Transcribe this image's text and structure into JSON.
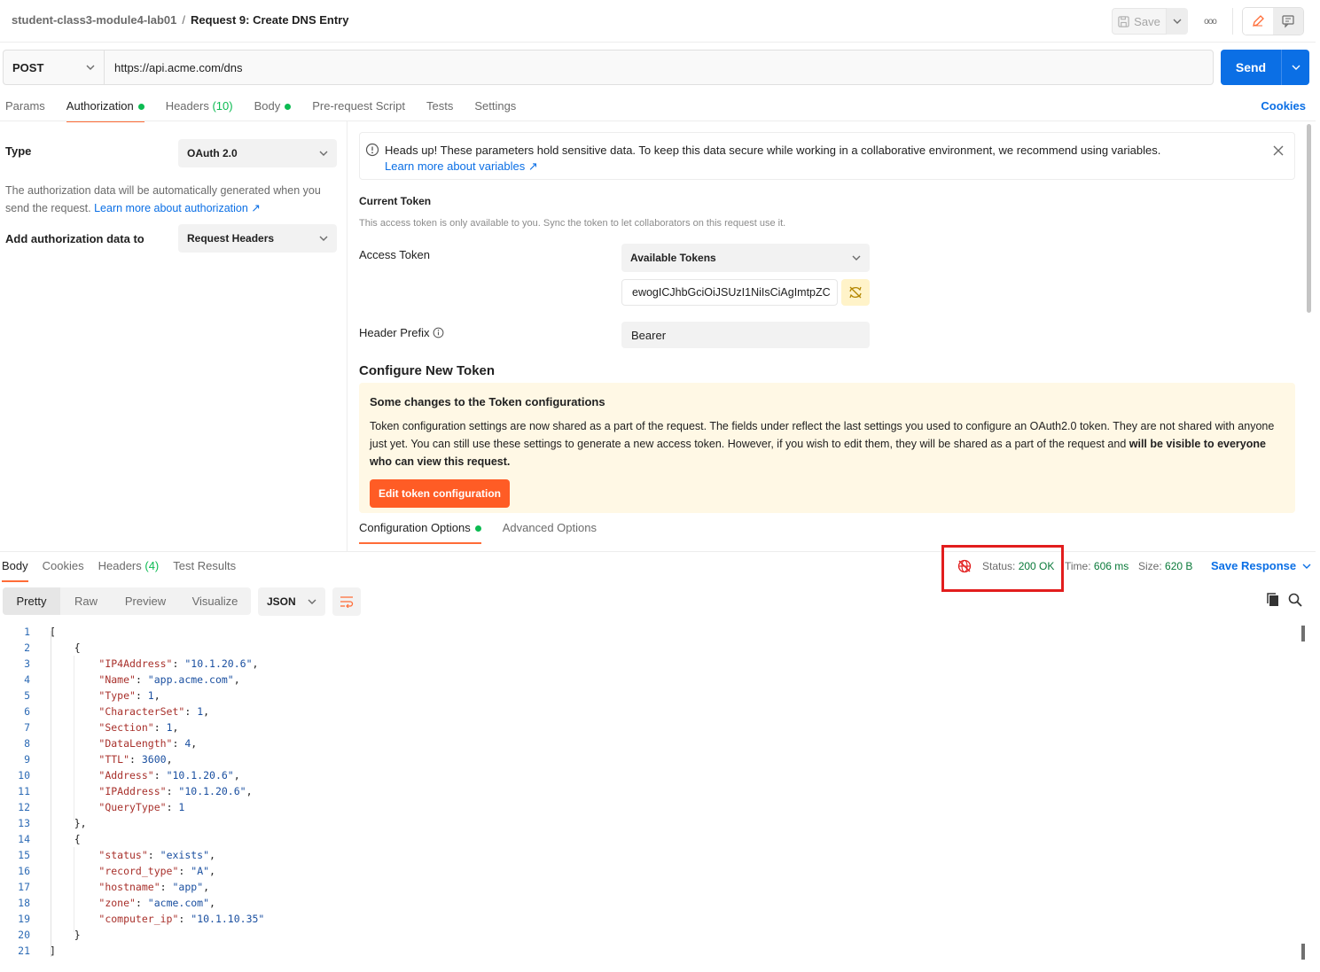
{
  "breadcrumb": {
    "workspace": "student-class3-module4-lab01",
    "separator": "/",
    "request": "Request 9: Create DNS Entry"
  },
  "topbar": {
    "save_label": "Save",
    "more_label": "ooo"
  },
  "request": {
    "method": "POST",
    "url": "https://api.acme.com/dns",
    "send_label": "Send"
  },
  "tabs": [
    {
      "label": "Params"
    },
    {
      "label": "Authorization"
    },
    {
      "label": "Headers",
      "count": "(10)"
    },
    {
      "label": "Body"
    },
    {
      "label": "Pre-request Script"
    },
    {
      "label": "Tests"
    },
    {
      "label": "Settings"
    }
  ],
  "cookies_label": "Cookies",
  "auth": {
    "type_label": "Type",
    "type_value": "OAuth 2.0",
    "desc_text": "The authorization data will be automatically generated when you send the request.",
    "desc_link": "Learn more about authorization ↗",
    "add_to_label": "Add authorization data to",
    "add_to_value": "Request Headers"
  },
  "warning": {
    "text": "Heads up! These parameters hold sensitive data. To keep this data secure while working in a collaborative environment, we recommend using variables.",
    "link": "Learn more about variables ↗"
  },
  "current_token": {
    "title": "Current Token",
    "subtitle": "This access token is only available to you. Sync the token to let collaborators on this request use it.",
    "access_label": "Access Token",
    "available_tokens": "Available Tokens",
    "token_value": "ewogICJhbGciOiJSUzI1NiIsCiAgImtpZC",
    "prefix_label": "Header Prefix",
    "prefix_value": "Bearer"
  },
  "configure": {
    "title": "Configure New Token",
    "notice_title": "Some changes to the Token configurations",
    "notice_body": "Token configuration settings are now shared as a part of the request. The fields under reflect the last settings you used to configure an OAuth2.0 token. They are not shared with anyone just yet. You can still use these settings to generate a new access token. However, if you wish to edit them, they will be shared as a part of the request and",
    "notice_bold": "will be visible to everyone who can view this request.",
    "edit_button": "Edit token configuration",
    "tab_config": "Configuration Options",
    "tab_advanced": "Advanced Options"
  },
  "response": {
    "tabs": [
      {
        "label": "Body"
      },
      {
        "label": "Cookies"
      },
      {
        "label": "Headers",
        "count": "(4)"
      },
      {
        "label": "Test Results"
      }
    ],
    "status_label": "Status:",
    "status_value": "200 OK",
    "time_label": "Time:",
    "time_value": "606 ms",
    "size_label": "Size:",
    "size_value": "620 B",
    "save_response": "Save Response",
    "views": [
      "Pretty",
      "Raw",
      "Preview",
      "Visualize"
    ],
    "format": "JSON"
  },
  "code_lines": [
    [
      {
        "t": "p",
        "v": "["
      }
    ],
    [
      {
        "t": "p",
        "v": "    {"
      }
    ],
    [
      {
        "t": "p",
        "v": "        "
      },
      {
        "t": "k",
        "v": "\"IP4Address\""
      },
      {
        "t": "p",
        "v": ": "
      },
      {
        "t": "s",
        "v": "\"10.1.20.6\""
      },
      {
        "t": "p",
        "v": ","
      }
    ],
    [
      {
        "t": "p",
        "v": "        "
      },
      {
        "t": "k",
        "v": "\"Name\""
      },
      {
        "t": "p",
        "v": ": "
      },
      {
        "t": "s",
        "v": "\"app.acme.com\""
      },
      {
        "t": "p",
        "v": ","
      }
    ],
    [
      {
        "t": "p",
        "v": "        "
      },
      {
        "t": "k",
        "v": "\"Type\""
      },
      {
        "t": "p",
        "v": ": "
      },
      {
        "t": "n",
        "v": "1"
      },
      {
        "t": "p",
        "v": ","
      }
    ],
    [
      {
        "t": "p",
        "v": "        "
      },
      {
        "t": "k",
        "v": "\"CharacterSet\""
      },
      {
        "t": "p",
        "v": ": "
      },
      {
        "t": "n",
        "v": "1"
      },
      {
        "t": "p",
        "v": ","
      }
    ],
    [
      {
        "t": "p",
        "v": "        "
      },
      {
        "t": "k",
        "v": "\"Section\""
      },
      {
        "t": "p",
        "v": ": "
      },
      {
        "t": "n",
        "v": "1"
      },
      {
        "t": "p",
        "v": ","
      }
    ],
    [
      {
        "t": "p",
        "v": "        "
      },
      {
        "t": "k",
        "v": "\"DataLength\""
      },
      {
        "t": "p",
        "v": ": "
      },
      {
        "t": "n",
        "v": "4"
      },
      {
        "t": "p",
        "v": ","
      }
    ],
    [
      {
        "t": "p",
        "v": "        "
      },
      {
        "t": "k",
        "v": "\"TTL\""
      },
      {
        "t": "p",
        "v": ": "
      },
      {
        "t": "n",
        "v": "3600"
      },
      {
        "t": "p",
        "v": ","
      }
    ],
    [
      {
        "t": "p",
        "v": "        "
      },
      {
        "t": "k",
        "v": "\"Address\""
      },
      {
        "t": "p",
        "v": ": "
      },
      {
        "t": "s",
        "v": "\"10.1.20.6\""
      },
      {
        "t": "p",
        "v": ","
      }
    ],
    [
      {
        "t": "p",
        "v": "        "
      },
      {
        "t": "k",
        "v": "\"IPAddress\""
      },
      {
        "t": "p",
        "v": ": "
      },
      {
        "t": "s",
        "v": "\"10.1.20.6\""
      },
      {
        "t": "p",
        "v": ","
      }
    ],
    [
      {
        "t": "p",
        "v": "        "
      },
      {
        "t": "k",
        "v": "\"QueryType\""
      },
      {
        "t": "p",
        "v": ": "
      },
      {
        "t": "n",
        "v": "1"
      }
    ],
    [
      {
        "t": "p",
        "v": "    },"
      }
    ],
    [
      {
        "t": "p",
        "v": "    {"
      }
    ],
    [
      {
        "t": "p",
        "v": "        "
      },
      {
        "t": "k",
        "v": "\"status\""
      },
      {
        "t": "p",
        "v": ": "
      },
      {
        "t": "s",
        "v": "\"exists\""
      },
      {
        "t": "p",
        "v": ","
      }
    ],
    [
      {
        "t": "p",
        "v": "        "
      },
      {
        "t": "k",
        "v": "\"record_type\""
      },
      {
        "t": "p",
        "v": ": "
      },
      {
        "t": "s",
        "v": "\"A\""
      },
      {
        "t": "p",
        "v": ","
      }
    ],
    [
      {
        "t": "p",
        "v": "        "
      },
      {
        "t": "k",
        "v": "\"hostname\""
      },
      {
        "t": "p",
        "v": ": "
      },
      {
        "t": "s",
        "v": "\"app\""
      },
      {
        "t": "p",
        "v": ","
      }
    ],
    [
      {
        "t": "p",
        "v": "        "
      },
      {
        "t": "k",
        "v": "\"zone\""
      },
      {
        "t": "p",
        "v": ": "
      },
      {
        "t": "s",
        "v": "\"acme.com\""
      },
      {
        "t": "p",
        "v": ","
      }
    ],
    [
      {
        "t": "p",
        "v": "        "
      },
      {
        "t": "k",
        "v": "\"computer_ip\""
      },
      {
        "t": "p",
        "v": ": "
      },
      {
        "t": "s",
        "v": "\"10.1.10.35\""
      }
    ],
    [
      {
        "t": "p",
        "v": "    }"
      }
    ],
    [
      {
        "t": "p",
        "v": "]"
      }
    ]
  ],
  "colors": {
    "accent": "#ff6c37",
    "primary": "#0b6fe5",
    "success": "#0cbb52",
    "highlight": "#e21d1d"
  }
}
